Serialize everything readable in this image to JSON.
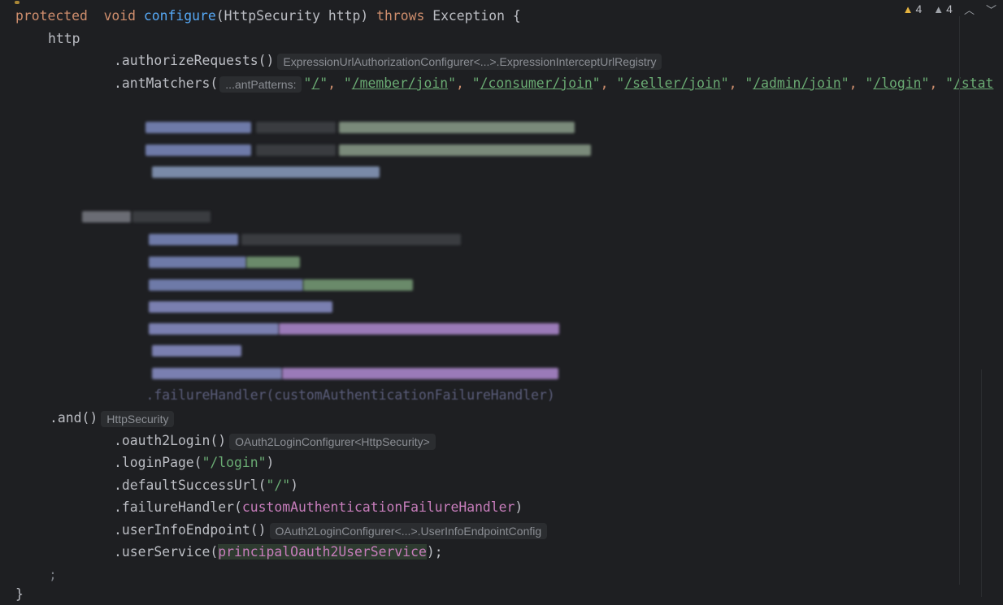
{
  "code": {
    "l1": {
      "kw": "protected",
      "kw2": "void",
      "fn": "configure",
      "rest": "(HttpSecurity http) ",
      "throws": "throws",
      "exc": " Exception {"
    },
    "l2": "http",
    "l3": {
      "method": ".authorizeRequests()",
      "hint": "ExpressionUrlAuthorizationConfigurer<...>.ExpressionInterceptUrlRegistry"
    },
    "l4": {
      "method": ".antMatchers(",
      "hint": "...antPatterns:",
      "q": "\"",
      "urls": [
        "/",
        "/member/join",
        "/consumer/join",
        "/seller/join",
        "/admin/join",
        "/login",
        "/stat"
      ],
      "comma": ", "
    },
    "l_and1": ".and()",
    "l_fail_blur": ".failureHandler(customAuthenticationFailureHandler)",
    "l_and2": ".and()",
    "l_and2_hint": "HttpSecurity",
    "l_oauth": ".oauth2Login()",
    "l_oauth_hint": "OAuth2LoginConfigurer<HttpSecurity>",
    "l_loginpage": {
      "m": ".loginPage(",
      "s": "\"/login\"",
      "e": ")"
    },
    "l_default": {
      "m": ".defaultSuccessUrl(",
      "s": "\"/\"",
      "e": ")"
    },
    "l_failure": {
      "m": ".failureHandler(",
      "f": "customAuthenticationFailureHandler",
      "e": ")"
    },
    "l_userinfo": ".userInfoEndpoint()",
    "l_userinfo_hint": "OAuth2LoginConfigurer<...>.UserInfoEndpointConfig",
    "l_userservice": {
      "m": ".userService(",
      "f": "principalOauth2UserService",
      "e": ");"
    },
    "l_semi": ";",
    "l_close": "}"
  },
  "status": {
    "warnings1": "4",
    "warnings2": "4",
    "chevron": "^"
  },
  "colors": {
    "keyword": "#cf8e6d",
    "function": "#56a8f5",
    "string": "#6aab73",
    "field": "#c77dbb",
    "background": "#1e1f22"
  }
}
